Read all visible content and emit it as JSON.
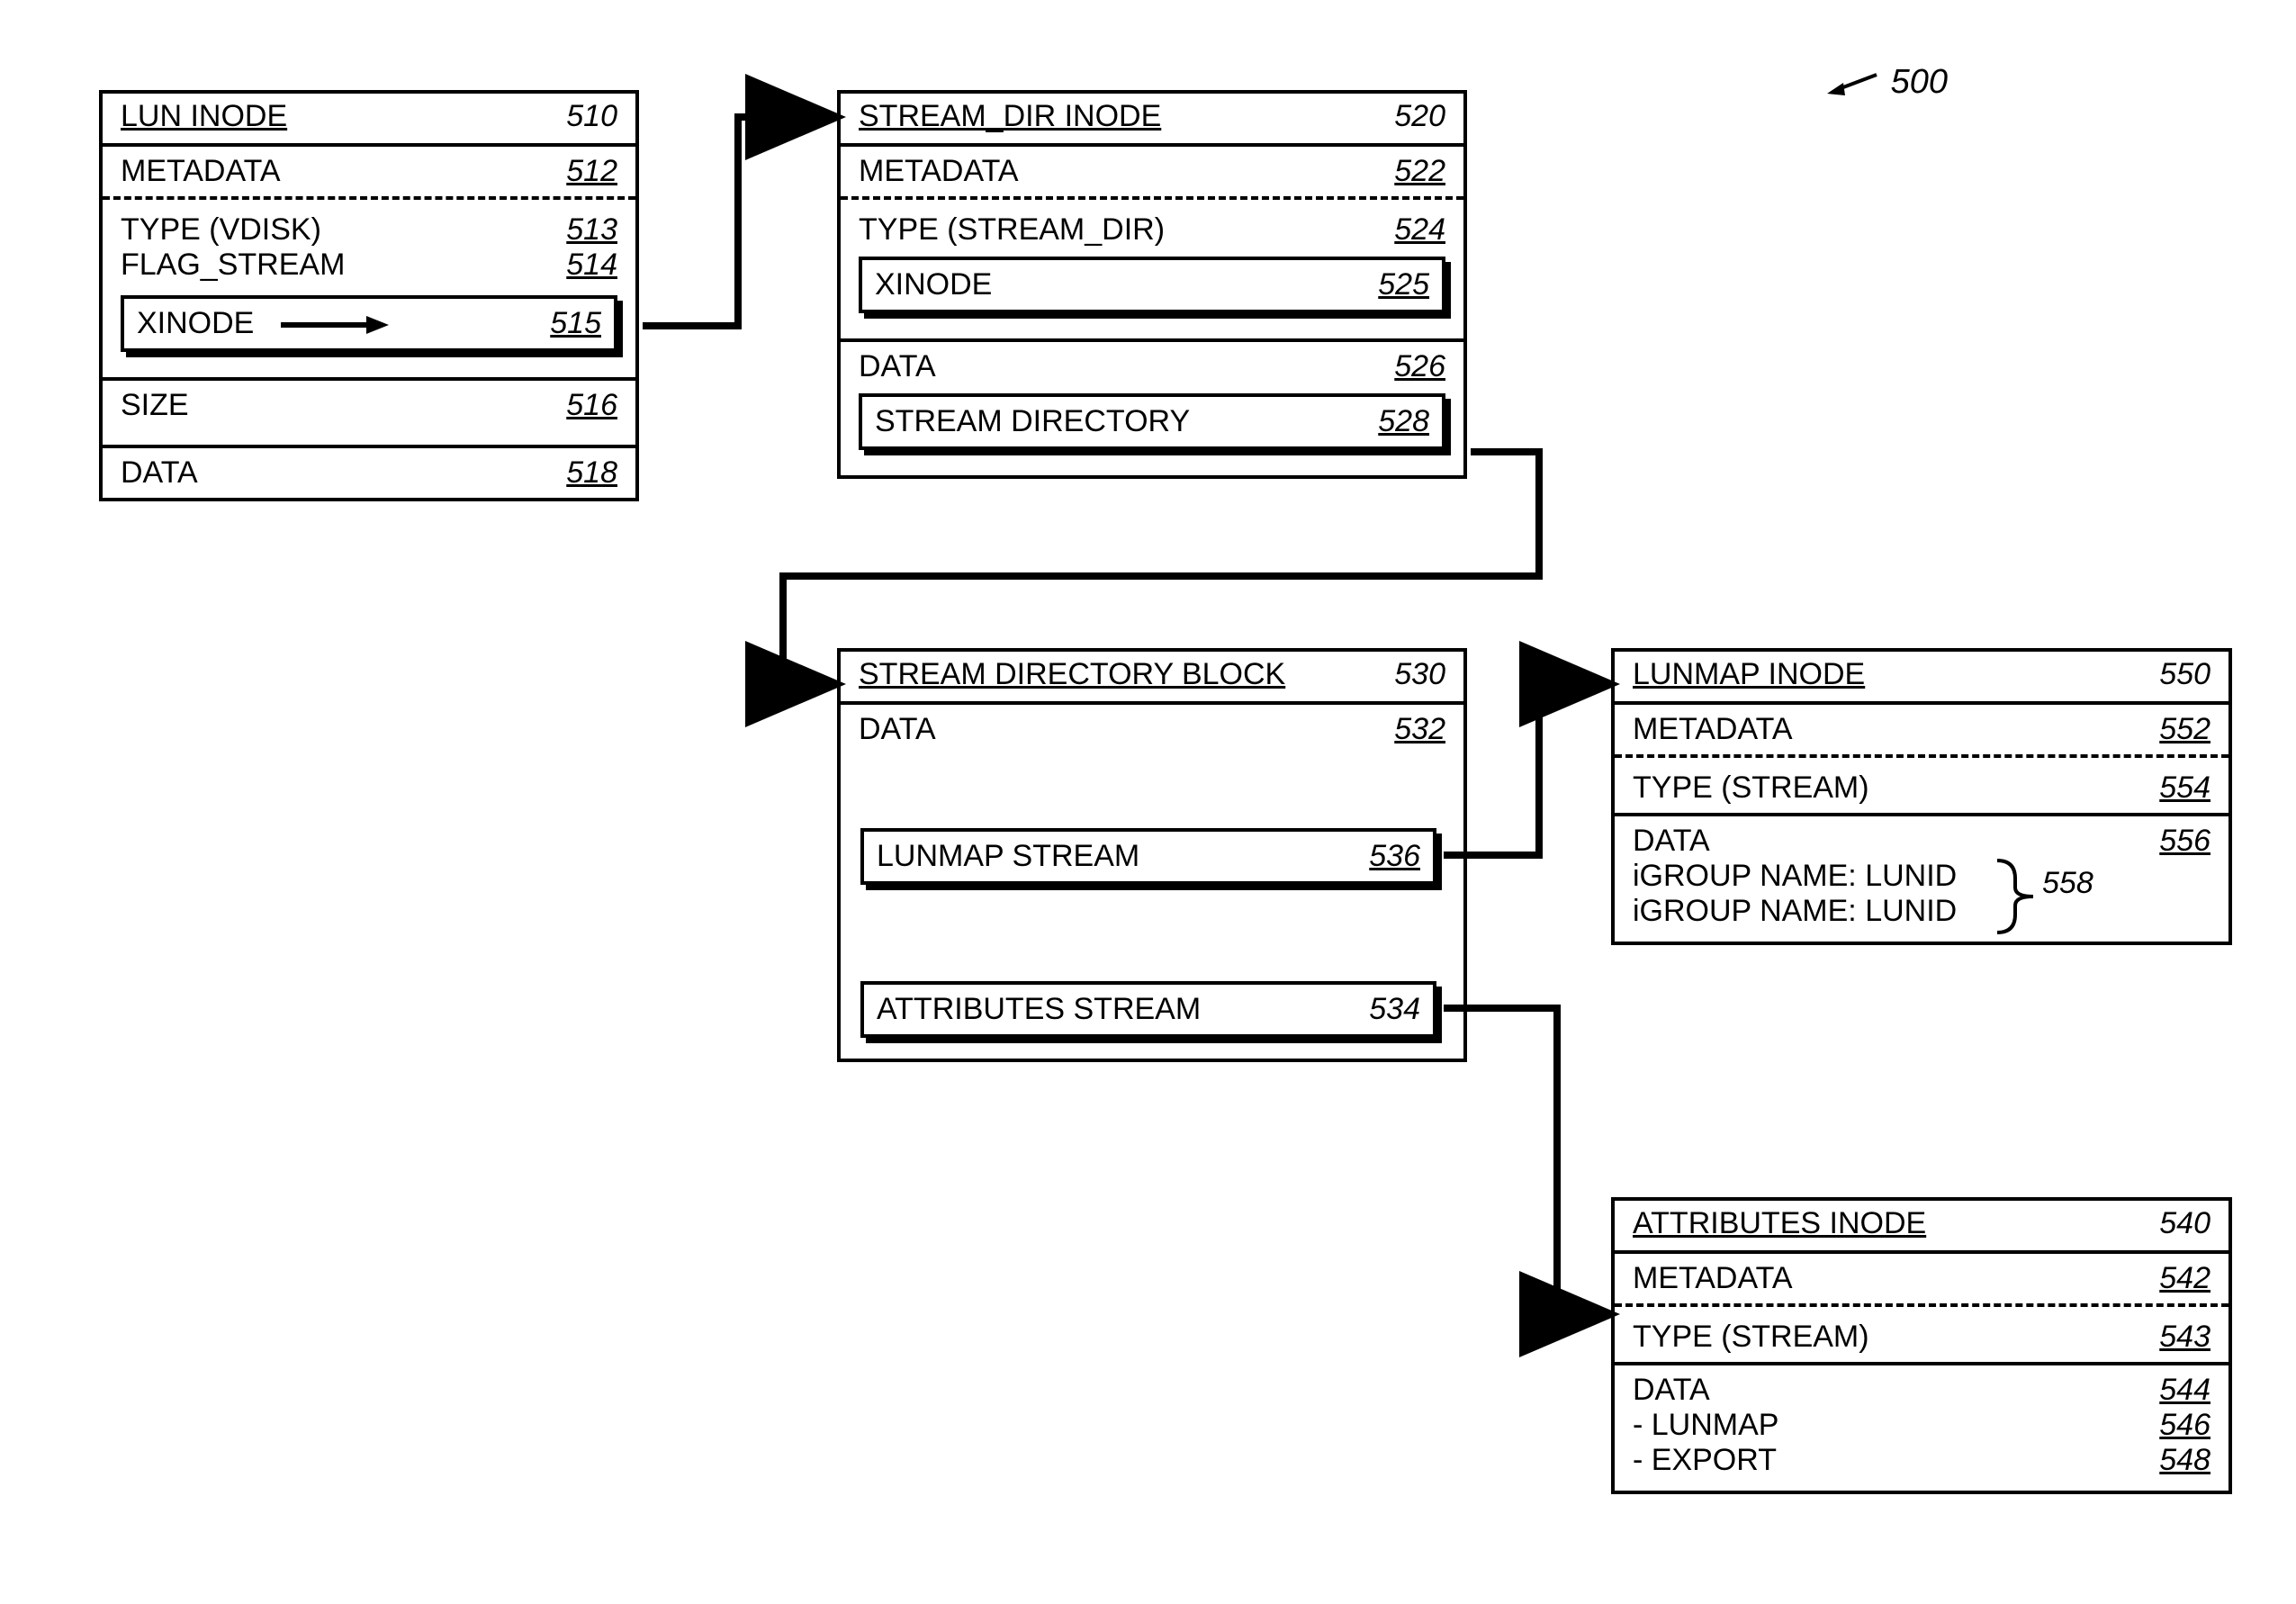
{
  "figure_ref": "500",
  "lun_inode": {
    "title": "LUN INODE",
    "num": "510",
    "metadata": "METADATA",
    "metadata_num": "512",
    "type": "TYPE (VDISK)",
    "type_num": "513",
    "flag": "FLAG_STREAM",
    "flag_num": "514",
    "xinode": "XINODE",
    "xinode_num": "515",
    "size": "SIZE",
    "size_num": "516",
    "data": "DATA",
    "data_num": "518"
  },
  "stream_dir_inode": {
    "title": "STREAM_DIR INODE",
    "num": "520",
    "metadata": "METADATA",
    "metadata_num": "522",
    "type": "TYPE (STREAM_DIR)",
    "type_num": "524",
    "xinode": "XINODE",
    "xinode_num": "525",
    "data": "DATA",
    "data_num": "526",
    "stream_dir": "STREAM DIRECTORY",
    "stream_dir_num": "528"
  },
  "stream_dir_block": {
    "title": "STREAM DIRECTORY BLOCK",
    "num": "530",
    "data": "DATA",
    "data_num": "532",
    "lunmap": "LUNMAP STREAM",
    "lunmap_num": "536",
    "attr": "ATTRIBUTES STREAM",
    "attr_num": "534"
  },
  "lunmap_inode": {
    "title": "LUNMAP INODE",
    "num": "550",
    "metadata": "METADATA",
    "metadata_num": "552",
    "type": "TYPE (STREAM)",
    "type_num": "554",
    "data": "DATA",
    "data_num": "556",
    "ig1": "iGROUP NAME: LUNID",
    "ig2": "iGROUP NAME: LUNID",
    "brace_num": "558"
  },
  "attributes_inode": {
    "title": "ATTRIBUTES INODE",
    "num": "540",
    "metadata": "METADATA",
    "metadata_num": "542",
    "type": "TYPE (STREAM)",
    "type_num": "543",
    "data": "DATA",
    "data_num": "544",
    "lunmap": "- LUNMAP",
    "lunmap_num": "546",
    "export": "- EXPORT",
    "export_num": "548"
  }
}
